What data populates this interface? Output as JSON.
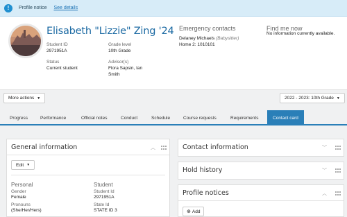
{
  "notice": {
    "label": "Profile notice",
    "link": "See details",
    "icon": "info-icon"
  },
  "profile": {
    "name": "Elisabeth \"Lizzie\" Zing '24",
    "student_id_label": "Student ID",
    "student_id": "2971951A",
    "grade_level_label": "Grade level",
    "grade_level": "10th Grade",
    "status_label": "Status",
    "status": "Current student",
    "advisor_label": "Advisor(s)",
    "advisor_line1": "Flora Sapsin, Ian",
    "advisor_line2": "Smith"
  },
  "emergency": {
    "title": "Emergency contacts",
    "contact_name": "Delaney Michaels",
    "contact_rel": "(Babysitter)",
    "contact_phone": "Home 2: 1010101"
  },
  "find_me": {
    "title": "Find me now",
    "value": "No information currently available."
  },
  "actions": {
    "more_actions": "More actions",
    "term": "2022 - 2023: 10th Grade"
  },
  "tabs": [
    "Progress",
    "Performance",
    "Official notes",
    "Conduct",
    "Schedule",
    "Course requests",
    "Requirements",
    "Contact card"
  ],
  "general": {
    "title": "General information",
    "edit": "Edit",
    "personal_title": "Personal",
    "gender_label": "Gender",
    "gender": "Female",
    "pronouns_label": "Pronouns",
    "pronouns": "(She/Her/Hers)",
    "student_title": "Student",
    "student_id_label": "Student Id",
    "student_id": "2971951A",
    "state_id_label": "State Id",
    "state_id": "STATE ID 3"
  },
  "contact_info": {
    "title": "Contact information"
  },
  "hold_history": {
    "title": "Hold history"
  },
  "profile_notices": {
    "title": "Profile notices",
    "add": "Add"
  },
  "colors": {
    "accent": "#2a7fb8",
    "name_blue": "#1c6aa3",
    "notice_bg": "#d7ecf8"
  }
}
